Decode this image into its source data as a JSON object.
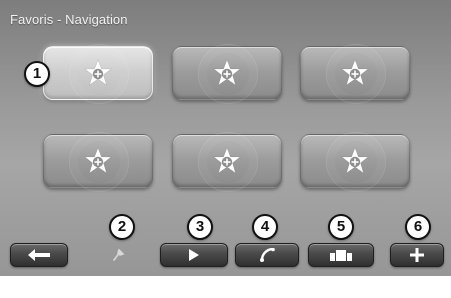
{
  "header": {
    "title": "Favoris - Navigation"
  },
  "favorites": {
    "buttons": [
      {
        "icon": "star-plus-icon",
        "selected": true
      },
      {
        "icon": "star-plus-icon",
        "selected": false
      },
      {
        "icon": "star-plus-icon",
        "selected": false
      },
      {
        "icon": "star-plus-icon",
        "selected": false
      },
      {
        "icon": "star-plus-icon",
        "selected": false
      },
      {
        "icon": "star-plus-icon",
        "selected": false
      }
    ]
  },
  "callouts": {
    "c1": "1",
    "c2": "2",
    "c3": "3",
    "c4": "4",
    "c5": "5",
    "c6": "6"
  },
  "bottom_bar": {
    "items": [
      {
        "icon": "arrow-left-icon"
      },
      {
        "icon": "pin-icon"
      },
      {
        "icon": "play-icon"
      },
      {
        "icon": "phone-icon"
      },
      {
        "icon": "media-icon"
      },
      {
        "icon": "plus-icon"
      }
    ]
  },
  "colors": {
    "background": "#9a9a9a",
    "favorite_button": "#a3a3a3",
    "favorite_button_selected": "#d6d6d6",
    "bar_button": "#3d3d3d",
    "callout_fill": "#ffffff",
    "callout_border": "#111111",
    "star": "#ffffff"
  }
}
